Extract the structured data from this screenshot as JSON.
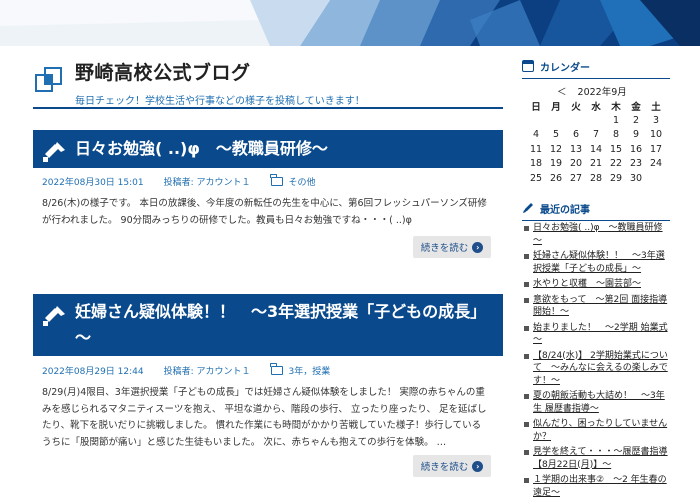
{
  "blog": {
    "title": "野崎高校公式ブログ",
    "subtitle": "毎日チェック！学校生活や行事などの様子を投稿していきます！"
  },
  "posts": [
    {
      "title": "日々お勉強( ..)φ　～教職員研修～",
      "date": "2022年08月30日 15:01",
      "author": "投稿者: アカウント１",
      "category": "その他",
      "excerpt": "8/26(木)の様子です。 本日の放課後、今年度の新転任の先生を中心に、第6回フレッシュパーソンズ研修が行われました。 90分間みっちりの研修でした。教員も日々お勉強ですね・・・( ..)φ",
      "read_more": "続きを読む"
    },
    {
      "title": "妊婦さん疑似体験！！　～3年選択授業「子どもの成長」～",
      "date": "2022年08月29日 12:44",
      "author": "投稿者: アカウント１",
      "category": "3年，授業",
      "excerpt": "8/29(月)4限目、3年選択授業「子どもの成長」では妊婦さん疑似体験をしました！ 実際の赤ちゃんの重みを感じられるマタニティスーツを抱え、 平坦な道から、階段の歩行、 立ったり座ったり、 足を延ばしたり、靴下を脱いだりに挑戦しました。 慣れた作業にも時間がかかり苦戦していた様子！歩行しているうちに「股関節が痛い」と感じた生徒もいました。 次に、赤ちゃんも抱えての歩行を体験。 …",
      "read_more": "続きを読む"
    }
  ],
  "calendar": {
    "heading": "カレンダー",
    "prev": "＜",
    "month": "2022年9月",
    "next": "＞",
    "weekdays": [
      "日",
      "月",
      "火",
      "水",
      "木",
      "金",
      "土"
    ],
    "weeks": [
      [
        "",
        "",
        "",
        "",
        "1",
        "2",
        "3"
      ],
      [
        "4",
        "5",
        "6",
        "7",
        "8",
        "9",
        "10"
      ],
      [
        "11",
        "12",
        "13",
        "14",
        "15",
        "16",
        "17"
      ],
      [
        "18",
        "19",
        "20",
        "21",
        "22",
        "23",
        "24"
      ],
      [
        "25",
        "26",
        "27",
        "28",
        "29",
        "30",
        ""
      ]
    ]
  },
  "recent": {
    "heading": "最近の記事",
    "items": [
      "日々お勉強( ..)φ　～教職員研修～",
      "妊婦さん疑似体験！！　～3年選択授業「子どもの成長」～",
      "水やりと収穫　～園芸部～",
      "意欲をもって　～第2回 面接指導開始！～",
      "始まりました！　～2学期 始業式～",
      "【8/24(水)】 2学期始業式について　～みんなに会えるの楽しみです！～",
      "夏の朝飯活動も大詰め！　～3年生 履歴書指導～",
      "似んだり、困ったりしていませんか？",
      "見学を終えて・・・～履歴書指導【8月22日(月)】～",
      "１学期の出来事②　～2 年生春の遠足～"
    ]
  },
  "colors": {
    "primary": "#0a4a8c",
    "link": "#1f6fb2"
  }
}
